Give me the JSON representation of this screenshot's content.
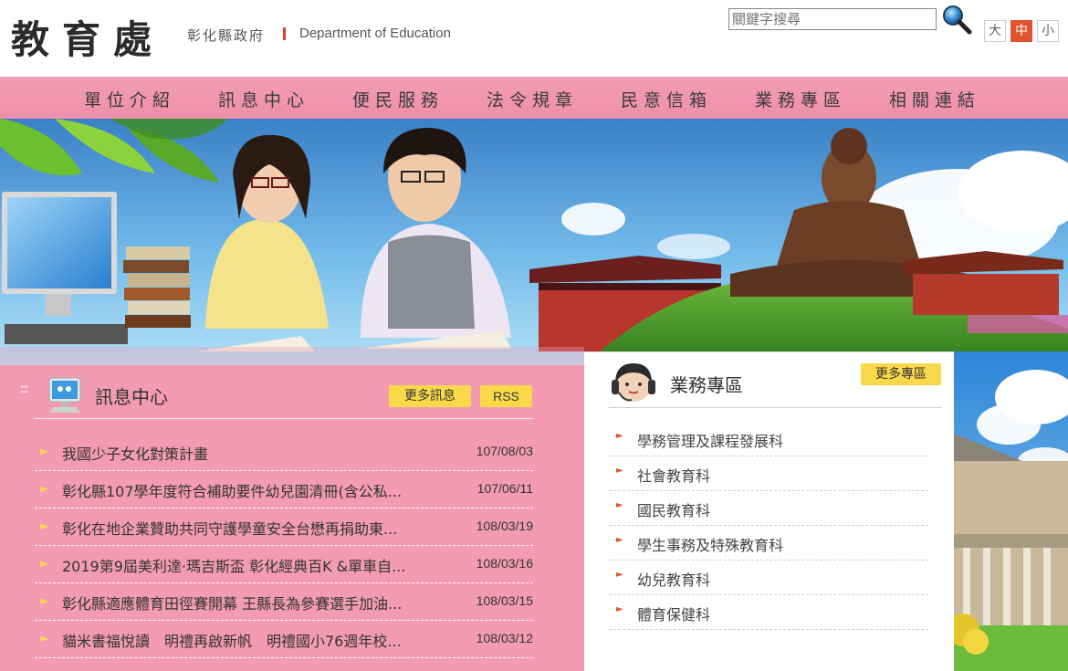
{
  "header": {
    "logo_main": "教育處",
    "logo_sub": "彰化縣政府",
    "logo_en": "Department of Education",
    "search_placeholder": "關鍵字搜尋",
    "font_sizes": [
      "大",
      "中",
      "小"
    ],
    "active_font_size": "中"
  },
  "nav": {
    "items": [
      "單位介紹",
      "訊息中心",
      "便民服務",
      "法令規章",
      "民意信箱",
      "業務專區",
      "相關連結"
    ]
  },
  "news": {
    "title": "訊息中心",
    "more_label": "更多訊息",
    "rss_label": "RSS",
    "items": [
      {
        "text": "我國少子女化對策計畫",
        "date": "107/08/03"
      },
      {
        "text": "彰化縣107學年度符合補助要件幼兒園清冊(含公私...",
        "date": "107/06/11"
      },
      {
        "text": "彰化在地企業贊助共同守護學童安全台懋再捐助東...",
        "date": "108/03/19"
      },
      {
        "text": "2019第9屆美利達·瑪吉斯盃 彰化經典百K &單車自...",
        "date": "108/03/16"
      },
      {
        "text": "彰化縣適應體育田徑賽開幕 王縣長為參賽選手加油...",
        "date": "108/03/15"
      },
      {
        "text": "貓米書福悅讀　明禮再啟新帆　明禮國小76週年校...",
        "date": "108/03/12"
      }
    ]
  },
  "business": {
    "title": "業務專區",
    "more_label": "更多專區",
    "items": [
      "學務管理及課程發展科",
      "社會教育科",
      "國民教育科",
      "學生事務及特殊教育科",
      "幼兒教育科",
      "體育保健科"
    ]
  },
  "colors": {
    "accent_pink": "#f39bb3",
    "button_yellow": "#f9d94a",
    "active_orange": "#e0532e"
  }
}
